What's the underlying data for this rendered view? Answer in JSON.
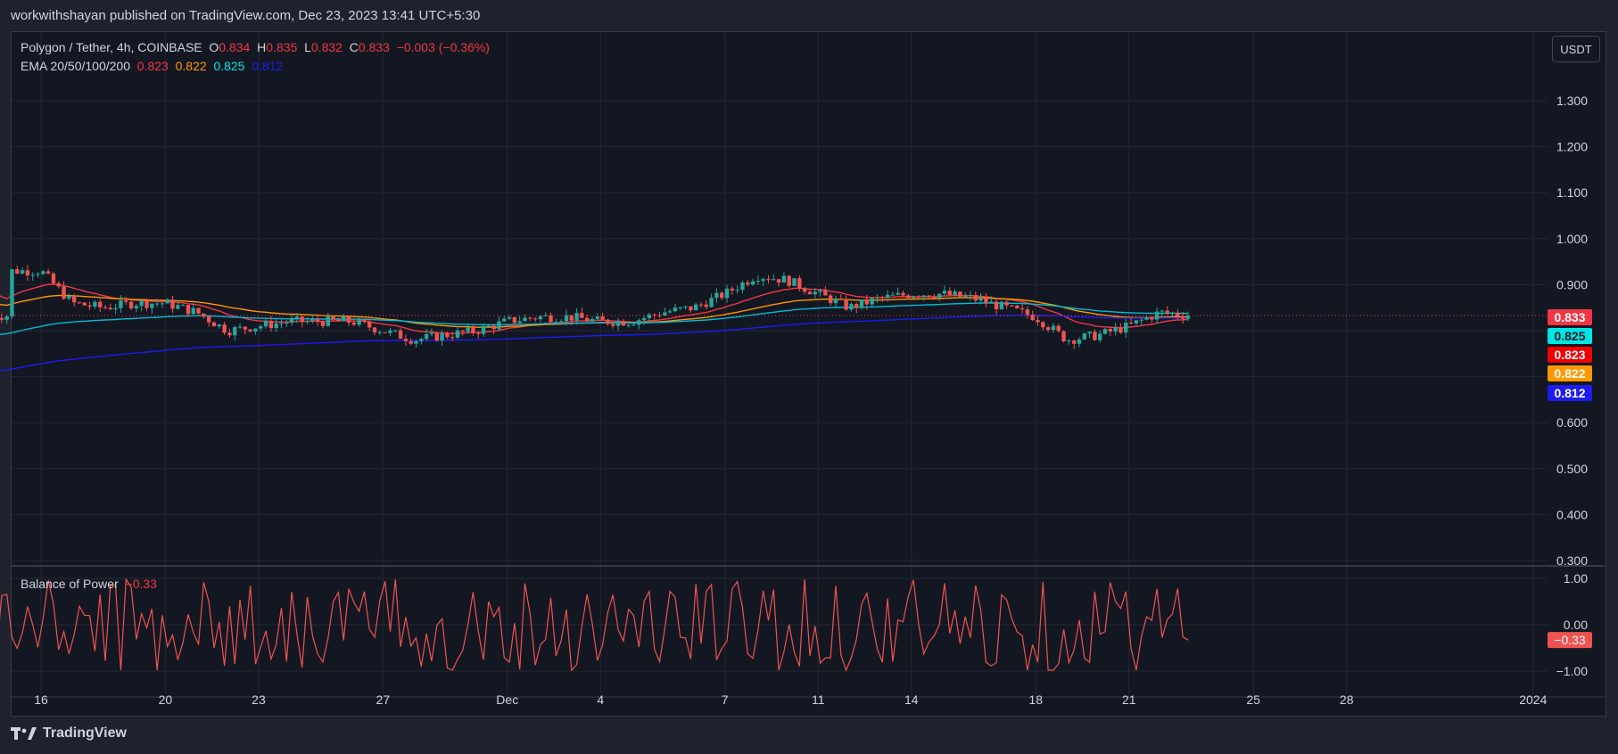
{
  "header": {
    "published": "workwithshayan published on TradingView.com, Dec 23, 2023 13:41 UTC+5:30"
  },
  "legend": {
    "symbol": "Polygon / Tether, 4h, COINBASE",
    "o_label": "O",
    "o_val": "0.834",
    "h_label": "H",
    "h_val": "0.835",
    "l_label": "L",
    "l_val": "0.832",
    "c_label": "C",
    "c_val": "0.833",
    "change": "−0.003 (−0.36%)",
    "ema_label": "EMA 20/50/100/200",
    "ema20": "0.823",
    "ema50": "0.822",
    "ema100": "0.825",
    "ema200": "0.812",
    "bop_label": "Balance of Power",
    "bop_val": "−0.33"
  },
  "currency_button": "USDT",
  "brand": {
    "name": "TradingView"
  },
  "colors": {
    "up": "#26a69a",
    "down": "#ef5350",
    "ema20": "#f23645",
    "ema50": "#ff9800",
    "ema100": "#00bcd4",
    "ema200": "#1c1cf0",
    "bop": "#ef5350",
    "bg": "#131722",
    "grid": "#232732"
  },
  "chart_data": [
    {
      "type": "candlestick",
      "title": "Polygon / Tether, 4h, COINBASE",
      "ylim": [
        0.3,
        1.35
      ],
      "y_ticks": [
        "1.300",
        "1.200",
        "1.100",
        "1.000",
        "0.900",
        "0.600",
        "0.500",
        "0.400",
        "0.300"
      ],
      "x_ticks": [
        "16",
        "20",
        "23",
        "27",
        "Dec",
        "4",
        "7",
        "11",
        "14",
        "18",
        "21",
        "25",
        "28",
        "2024"
      ],
      "price_badges": [
        {
          "label": "0.833",
          "value": 0.833,
          "color": "#f23645"
        },
        {
          "label": "0.825",
          "value": 0.825,
          "color": "#00e5e5"
        },
        {
          "label": "0.823",
          "value": 0.823,
          "color": "#f20000"
        },
        {
          "label": "0.822",
          "value": 0.822,
          "color": "#ff9800"
        },
        {
          "label": "0.812",
          "value": 0.812,
          "color": "#1c1cf0"
        }
      ],
      "last_price": 0.833,
      "close_path": [
        [
          "Nov 15",
          0.93
        ],
        [
          "Nov 16",
          0.93
        ],
        [
          "Nov 17",
          0.86
        ],
        [
          "Nov 18",
          0.85
        ],
        [
          "Nov 19",
          0.86
        ],
        [
          "Nov 20",
          0.86
        ],
        [
          "Nov 21",
          0.84
        ],
        [
          "Nov 22",
          0.8
        ],
        [
          "Nov 23",
          0.81
        ],
        [
          "Nov 24",
          0.82
        ],
        [
          "Nov 25",
          0.82
        ],
        [
          "Nov 26",
          0.82
        ],
        [
          "Nov 27",
          0.8
        ],
        [
          "Nov 28",
          0.78
        ],
        [
          "Nov 29",
          0.79
        ],
        [
          "Nov 30",
          0.8
        ],
        [
          "Dec 1",
          0.82
        ],
        [
          "Dec 2",
          0.83
        ],
        [
          "Dec 3",
          0.83
        ],
        [
          "Dec 4",
          0.82
        ],
        [
          "Dec 5",
          0.82
        ],
        [
          "Dec 6",
          0.84
        ],
        [
          "Dec 7",
          0.85
        ],
        [
          "Dec 8",
          0.88
        ],
        [
          "Dec 9",
          0.92
        ],
        [
          "Dec 10",
          0.91
        ],
        [
          "Dec 11",
          0.88
        ],
        [
          "Dec 12",
          0.85
        ],
        [
          "Dec 13",
          0.87
        ],
        [
          "Dec 14",
          0.88
        ],
        [
          "Dec 15",
          0.88
        ],
        [
          "Dec 16",
          0.87
        ],
        [
          "Dec 17",
          0.85
        ],
        [
          "Dec 18",
          0.83
        ],
        [
          "Dec 19",
          0.78
        ],
        [
          "Dec 20",
          0.79
        ],
        [
          "Dec 21",
          0.81
        ],
        [
          "Dec 22",
          0.84
        ],
        [
          "Dec 23",
          0.833
        ]
      ]
    },
    {
      "type": "line",
      "title": "Balance of Power",
      "ylim": [
        -1.2,
        1.2
      ],
      "y_ticks": [
        "1.00",
        "0.00",
        "−1.00"
      ],
      "last_value": -0.33,
      "value_badge": "−0.33"
    }
  ]
}
